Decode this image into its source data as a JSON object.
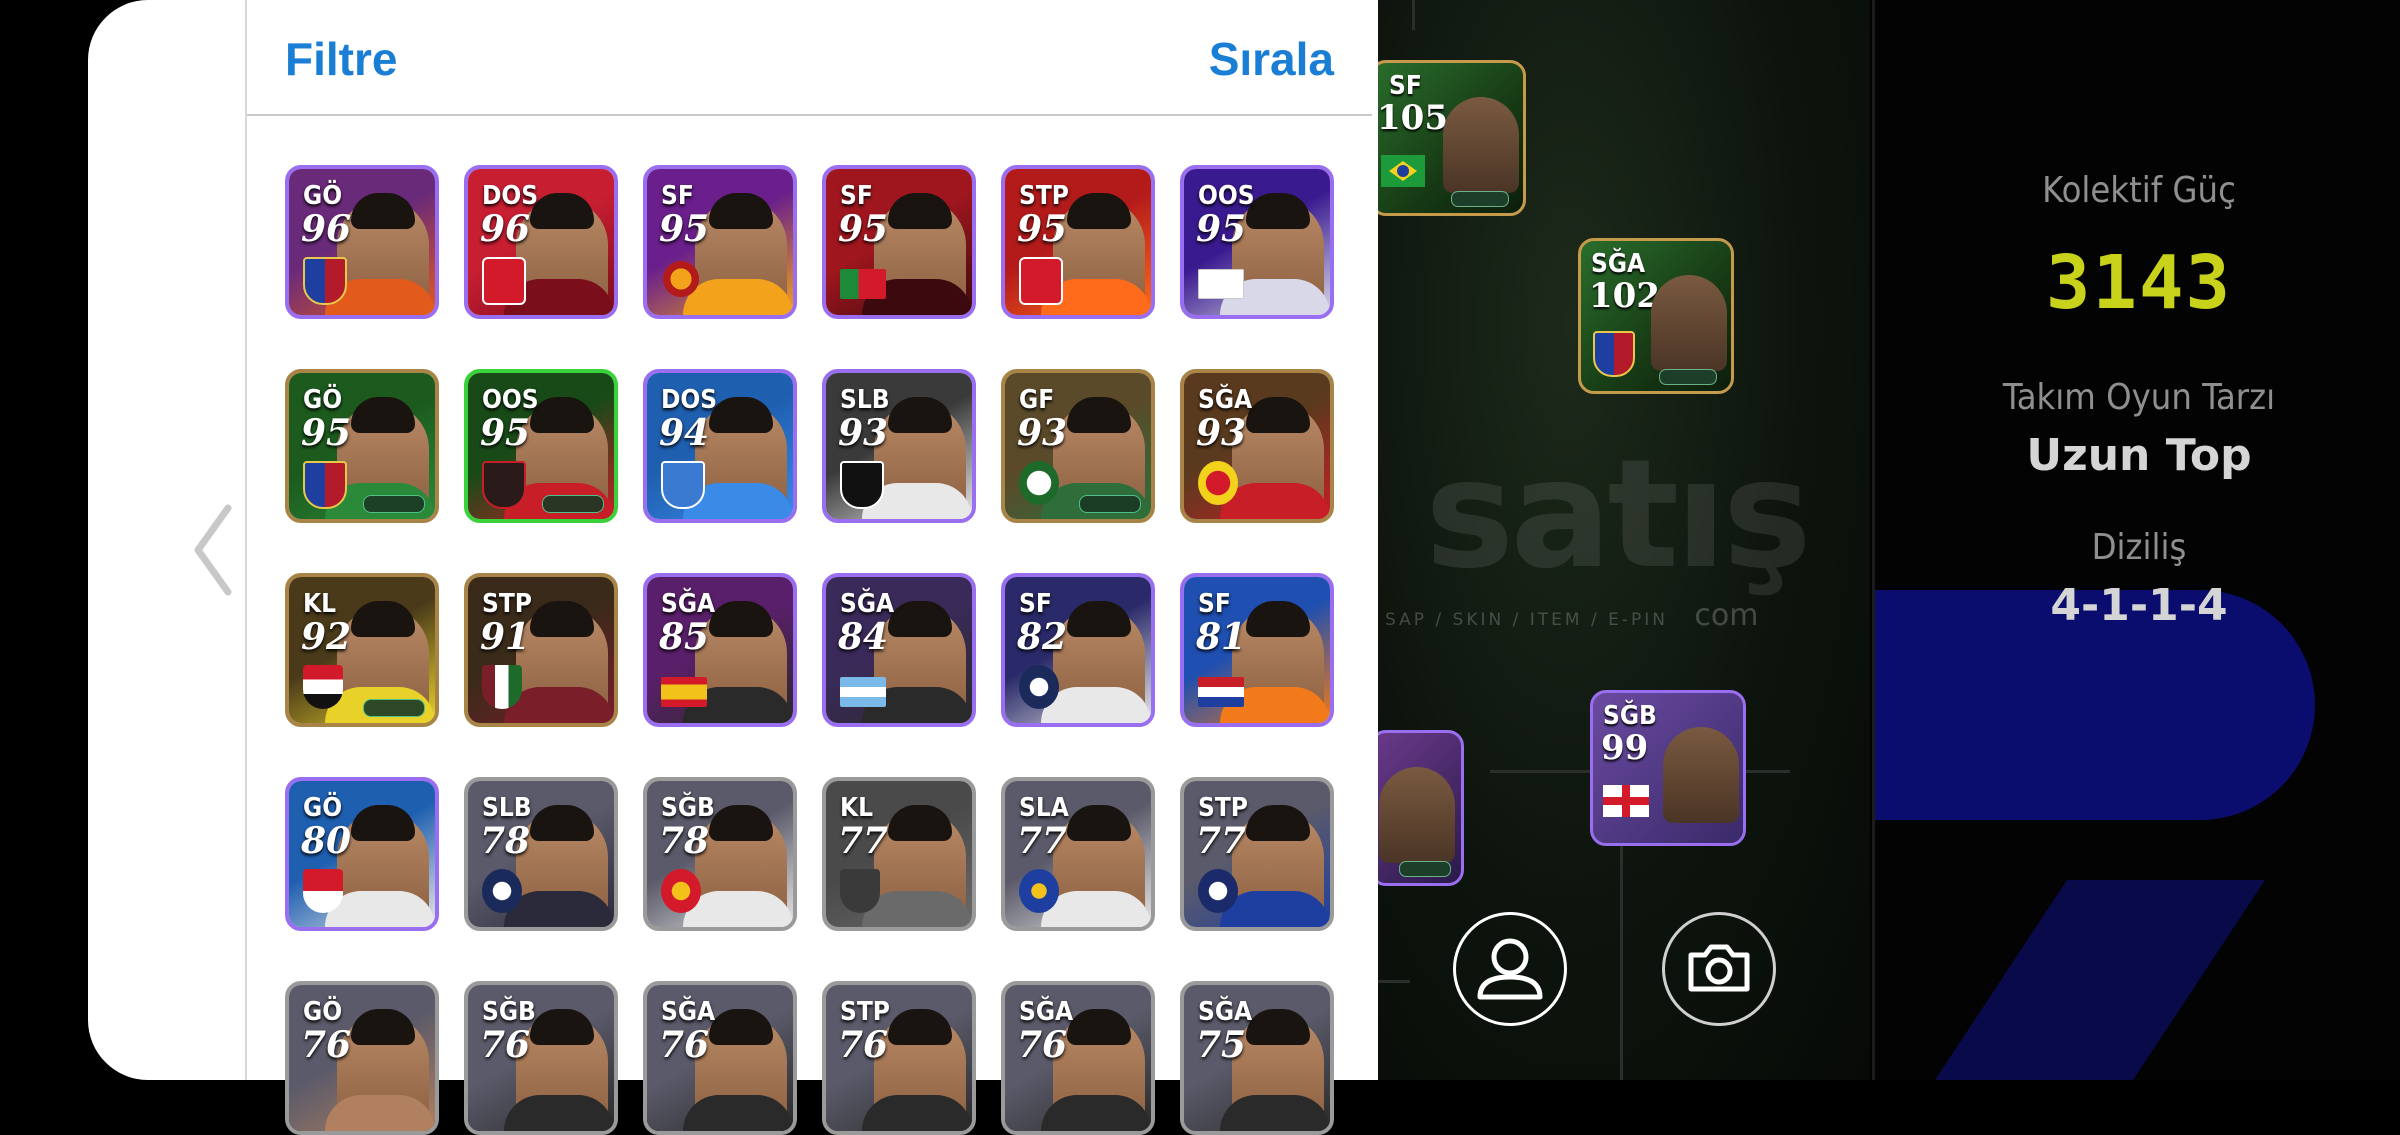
{
  "header": {
    "filter_label": "Filtre",
    "sort_label": "Sırala"
  },
  "players": [
    {
      "pos": "GÖ",
      "ovr": "96",
      "tier": "purple",
      "bg": "#6a2a7a",
      "accent": "#e35a1d",
      "badge": "barca"
    },
    {
      "pos": "DOS",
      "ovr": "96",
      "tier": "purple",
      "bg": "#c81e32",
      "accent": "#7a0e1a",
      "badge": "red"
    },
    {
      "pos": "SF",
      "ovr": "95",
      "tier": "purple",
      "bg": "#6a1f8c",
      "accent": "#f2a31b",
      "badge": "gala"
    },
    {
      "pos": "SF",
      "ovr": "95",
      "tier": "purple",
      "bg": "#a0161f",
      "accent": "#3c0a0e",
      "badge": "portugal"
    },
    {
      "pos": "STP",
      "ovr": "95",
      "tier": "purple",
      "bg": "#b31a1a",
      "accent": "#ff6b1a",
      "badge": "red"
    },
    {
      "pos": "OOS",
      "ovr": "95",
      "tier": "purple",
      "bg": "#3a1a8f",
      "accent": "#d8d8e8",
      "badge": "england"
    },
    {
      "pos": "GÖ",
      "ovr": "95",
      "tier": "gold",
      "bg": "#1c5a1e",
      "accent": "#2a8a3a",
      "badge": "barca",
      "chips": true
    },
    {
      "pos": "OOS",
      "ovr": "95",
      "tier": "green",
      "bg": "#184a18",
      "accent": "#c81e28",
      "badge": "dark",
      "chips": true
    },
    {
      "pos": "DOS",
      "ovr": "94",
      "tier": "purple",
      "bg": "#1f5fb0",
      "accent": "#3a8ae8",
      "badge": "blue"
    },
    {
      "pos": "SLB",
      "ovr": "93",
      "tier": "purple",
      "bg": "#3a3a3a",
      "accent": "#e8e8e8",
      "badge": "star"
    },
    {
      "pos": "GF",
      "ovr": "93",
      "tier": "gold",
      "bg": "#5a4a2a",
      "accent": "#2f6e3a",
      "badge": "palmeiras",
      "chips": true
    },
    {
      "pos": "SĞA",
      "ovr": "93",
      "tier": "gold",
      "bg": "#5a3a1e",
      "accent": "#c81e28",
      "badge": "benfica"
    },
    {
      "pos": "KL",
      "ovr": "92",
      "tier": "gold",
      "bg": "#4a3a1a",
      "accent": "#e8d22a",
      "badge": "sp",
      "chips": true
    },
    {
      "pos": "STP",
      "ovr": "91",
      "tier": "gold",
      "bg": "#3a2a1a",
      "accent": "#7a1e2a",
      "badge": "flu"
    },
    {
      "pos": "SĞA",
      "ovr": "85",
      "tier": "purple",
      "bg": "#5a1f6a",
      "accent": "#2a2a2a",
      "badge": "spain"
    },
    {
      "pos": "SĞA",
      "ovr": "84",
      "tier": "purple",
      "bg": "#3a2a5a",
      "accent": "#2a2a2a",
      "badge": "argentina"
    },
    {
      "pos": "SF",
      "ovr": "82",
      "tier": "purple",
      "bg": "#2a2a6a",
      "accent": "#e8e8e8",
      "badge": "spurs"
    },
    {
      "pos": "SF",
      "ovr": "81",
      "tier": "purple",
      "bg": "#1f4fb0",
      "accent": "#f27a1b",
      "badge": "netherlands"
    },
    {
      "pos": "GÖ",
      "ovr": "80",
      "tier": "purple",
      "bg": "#1f5fb0",
      "accent": "#e8e8e8",
      "badge": "monaco"
    },
    {
      "pos": "SLB",
      "ovr": "78",
      "tier": "silver",
      "bg": "#5a5a6a",
      "accent": "#2a2a3a",
      "badge": "spurs"
    },
    {
      "pos": "SĞB",
      "ovr": "78",
      "tier": "silver",
      "bg": "#5a5a6a",
      "accent": "#e8e8e8",
      "badge": "manutd"
    },
    {
      "pos": "KL",
      "ovr": "77",
      "tier": "silver",
      "bg": "#4a4a4a",
      "accent": "#6a6a6a",
      "badge": "shield"
    },
    {
      "pos": "SLA",
      "ovr": "77",
      "tier": "silver",
      "bg": "#5a5a6a",
      "accent": "#e8e8e8",
      "badge": "chelsea"
    },
    {
      "pos": "STP",
      "ovr": "77",
      "tier": "silver",
      "bg": "#5a5a6a",
      "accent": "#1f3fa0",
      "badge": "atalanta"
    },
    {
      "pos": "GÖ",
      "ovr": "76",
      "tier": "silver",
      "bg": "#5a5a6a",
      "accent": "#b08060",
      "badge": "none"
    },
    {
      "pos": "SĞB",
      "ovr": "76",
      "tier": "silver",
      "bg": "#5a5a6a",
      "accent": "#2a2a2a",
      "badge": "none"
    },
    {
      "pos": "SĞA",
      "ovr": "76",
      "tier": "silver",
      "bg": "#5a5a6a",
      "accent": "#2a2a2a",
      "badge": "none"
    },
    {
      "pos": "STP",
      "ovr": "76",
      "tier": "silver",
      "bg": "#5a5a6a",
      "accent": "#2a2a2a",
      "badge": "none"
    },
    {
      "pos": "SĞA",
      "ovr": "76",
      "tier": "silver",
      "bg": "#5a5a6a",
      "accent": "#2a2a2a",
      "badge": "none"
    },
    {
      "pos": "SĞA",
      "ovr": "75",
      "tier": "silver",
      "bg": "#5a5a6a",
      "accent": "#2a2a2a",
      "badge": "none"
    }
  ],
  "pitch_players": [
    {
      "pos": "SF",
      "ovr": "105",
      "flag": "brazil"
    },
    {
      "pos": "SĞA",
      "ovr": "102",
      "flag": "barca"
    },
    {
      "pos": "SĞB",
      "ovr": "99",
      "flag": "england"
    }
  ],
  "watermark": {
    "brand": "satış",
    "tagline": "SAP / SKIN / ITEM / E-PIN",
    "domain": "com"
  },
  "team": {
    "power_label": "Kolektif Güç",
    "power_value": "3143",
    "style_label": "Takım Oyun Tarzı",
    "style_value": "Uzun Top",
    "formation_label": "Diziliş",
    "formation_value": "4-1-1-4"
  },
  "icons": {
    "back": "chevron-left-icon",
    "profile": "user-icon",
    "camera": "camera-icon"
  }
}
